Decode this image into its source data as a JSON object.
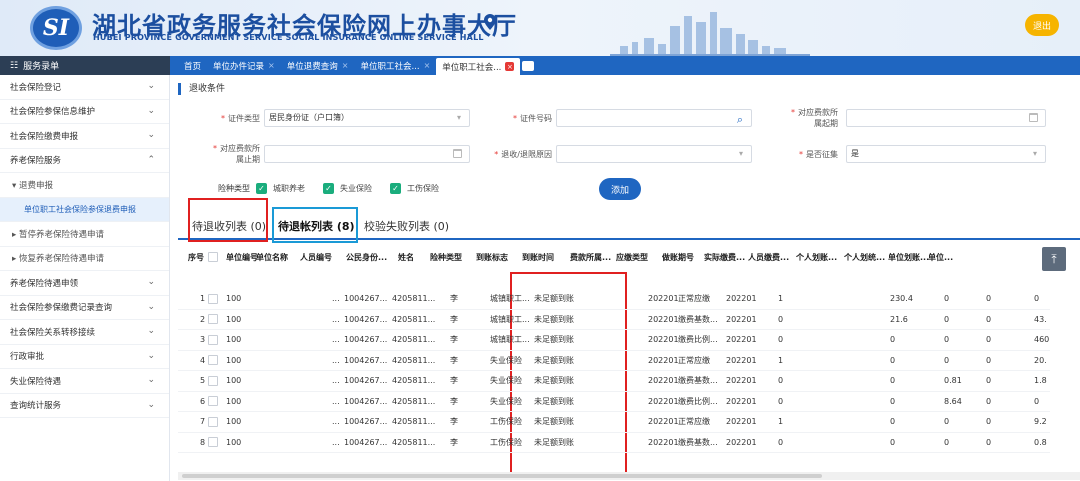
{
  "header": {
    "logo_text": "SI",
    "title_zh": "湖北省政务服务社会保险网上办事大厅",
    "title_en": "HUBEI PROVINCE GOVERNMENT SERVICE SOCIAL INSURANCE ONLINE SERVICE HALL",
    "logout_label": "退出",
    "accent": "#1c4fa0"
  },
  "navbar": {
    "menu_title": "服务录单",
    "tabs": [
      {
        "label": "首页"
      },
      {
        "label": "单位办件记录"
      },
      {
        "label": "单位退费查询"
      },
      {
        "label": "单位职工社会..."
      },
      {
        "label": "单位职工社会..."
      }
    ]
  },
  "sidebar": {
    "items": [
      {
        "label": "社会保险登记",
        "chev": "⌄"
      },
      {
        "label": "社会保险参保信息维护",
        "chev": "⌄"
      },
      {
        "label": "社会保险缴费申报",
        "chev": "⌄"
      },
      {
        "label": "养老保险服务",
        "chev": "⌃"
      },
      {
        "label": "▾ 退费申报",
        "chev": ""
      },
      {
        "label": "单位职工社会保险参保退费申报",
        "chev": ""
      },
      {
        "label": "▸ 暂停养老保险待遇申请",
        "chev": ""
      },
      {
        "label": "▸ 恢复养老保险待遇申请",
        "chev": ""
      },
      {
        "label": "养老保险待遇申领",
        "chev": "⌄"
      },
      {
        "label": "社会保险参保缴费记录查询",
        "chev": "⌄"
      },
      {
        "label": "社会保险关系转移接续",
        "chev": "⌄"
      },
      {
        "label": "行政审批",
        "chev": "⌄"
      },
      {
        "label": "失业保险待遇",
        "chev": "⌄"
      },
      {
        "label": "查询统计服务",
        "chev": "⌄"
      }
    ]
  },
  "form": {
    "section_title": "退收条件",
    "id_type_label": "证件类型",
    "id_type_value": "居民身份证（户口簿）",
    "id_no_label": "证件号码",
    "period_start_label": "对应费款所属起期",
    "period_end_label": "对应费款所属止期",
    "reason_label": "退收/退限原因",
    "levy_label": "是否征集",
    "levy_value": "是",
    "insurance_label": "险种类型",
    "insurance_options": [
      "城职养老",
      "失业保险",
      "工伤保险"
    ],
    "add_label": "添加"
  },
  "result_tabs": [
    {
      "label": "待退收列表",
      "count": "(0)"
    },
    {
      "label": "待退帐列表",
      "count": "(8)"
    },
    {
      "label": "校验失败列表",
      "count": "(0)"
    }
  ],
  "table": {
    "headers": [
      "序号",
      "单位编号",
      "单位名称",
      "人员编号",
      "公民身份...",
      "姓名",
      "险种类型",
      "到账标志",
      "到账时间",
      "费款所属...",
      "应缴类型",
      "做账期号",
      "实际缴费...",
      "人员缴费...",
      "个人划账...",
      "个人划统...",
      "单位划账...",
      "单位..."
    ],
    "rows": [
      [
        "1",
        "100",
        "...",
        "1004267...",
        "4205811...",
        "李",
        "城镇职工...",
        "未足额到账",
        "",
        "202201",
        "正常应缴",
        "202201",
        "1",
        "",
        "230.4",
        "0",
        "0",
        "0"
      ],
      [
        "2",
        "100",
        "...",
        "1004267...",
        "4205811...",
        "李",
        "城镇职工...",
        "未足额到账",
        "",
        "202201",
        "缴费基数...",
        "202201",
        "0",
        "",
        "21.6",
        "0",
        "0",
        "43."
      ],
      [
        "3",
        "100",
        "...",
        "1004267...",
        "4205811...",
        "李",
        "城镇职工...",
        "未足额到账",
        "",
        "202201",
        "缴费比例...",
        "202201",
        "0",
        "",
        "0",
        "0",
        "0",
        "460"
      ],
      [
        "4",
        "100",
        "...",
        "1004267...",
        "4205811...",
        "李",
        "失业保险",
        "未足额到账",
        "",
        "202201",
        "正常应缴",
        "202201",
        "1",
        "",
        "0",
        "0",
        "0",
        "20."
      ],
      [
        "5",
        "100",
        "...",
        "1004267...",
        "4205811...",
        "李",
        "失业保险",
        "未足额到账",
        "",
        "202201",
        "缴费基数...",
        "202201",
        "0",
        "",
        "0",
        "0.81",
        "0",
        "1.8"
      ],
      [
        "6",
        "100",
        "...",
        "1004267...",
        "4205811...",
        "李",
        "失业保险",
        "未足额到账",
        "",
        "202201",
        "缴费比例...",
        "202201",
        "0",
        "",
        "0",
        "8.64",
        "0",
        "0"
      ],
      [
        "7",
        "100",
        "...",
        "1004267...",
        "4205811...",
        "李",
        "工伤保险",
        "未足额到账",
        "",
        "202201",
        "正常应缴",
        "202201",
        "1",
        "",
        "0",
        "0",
        "0",
        "9.2"
      ],
      [
        "8",
        "100",
        "...",
        "1004267...",
        "4205811...",
        "李",
        "工伤保险",
        "未足额到账",
        "",
        "202201",
        "缴费基数...",
        "202201",
        "0",
        "",
        "0",
        "0",
        "0",
        "0.8"
      ]
    ]
  }
}
